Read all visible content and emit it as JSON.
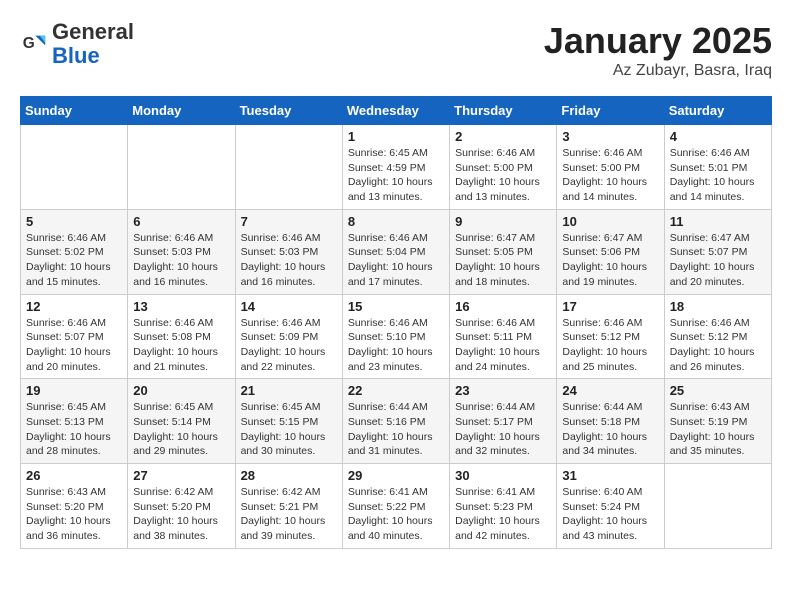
{
  "header": {
    "logo_general": "General",
    "logo_blue": "Blue",
    "month_title": "January 2025",
    "location": "Az Zubayr, Basra, Iraq"
  },
  "days_of_week": [
    "Sunday",
    "Monday",
    "Tuesday",
    "Wednesday",
    "Thursday",
    "Friday",
    "Saturday"
  ],
  "weeks": [
    [
      {
        "day": "",
        "info": ""
      },
      {
        "day": "",
        "info": ""
      },
      {
        "day": "",
        "info": ""
      },
      {
        "day": "1",
        "info": "Sunrise: 6:45 AM\nSunset: 4:59 PM\nDaylight: 10 hours\nand 13 minutes."
      },
      {
        "day": "2",
        "info": "Sunrise: 6:46 AM\nSunset: 5:00 PM\nDaylight: 10 hours\nand 13 minutes."
      },
      {
        "day": "3",
        "info": "Sunrise: 6:46 AM\nSunset: 5:00 PM\nDaylight: 10 hours\nand 14 minutes."
      },
      {
        "day": "4",
        "info": "Sunrise: 6:46 AM\nSunset: 5:01 PM\nDaylight: 10 hours\nand 14 minutes."
      }
    ],
    [
      {
        "day": "5",
        "info": "Sunrise: 6:46 AM\nSunset: 5:02 PM\nDaylight: 10 hours\nand 15 minutes."
      },
      {
        "day": "6",
        "info": "Sunrise: 6:46 AM\nSunset: 5:03 PM\nDaylight: 10 hours\nand 16 minutes."
      },
      {
        "day": "7",
        "info": "Sunrise: 6:46 AM\nSunset: 5:03 PM\nDaylight: 10 hours\nand 16 minutes."
      },
      {
        "day": "8",
        "info": "Sunrise: 6:46 AM\nSunset: 5:04 PM\nDaylight: 10 hours\nand 17 minutes."
      },
      {
        "day": "9",
        "info": "Sunrise: 6:47 AM\nSunset: 5:05 PM\nDaylight: 10 hours\nand 18 minutes."
      },
      {
        "day": "10",
        "info": "Sunrise: 6:47 AM\nSunset: 5:06 PM\nDaylight: 10 hours\nand 19 minutes."
      },
      {
        "day": "11",
        "info": "Sunrise: 6:47 AM\nSunset: 5:07 PM\nDaylight: 10 hours\nand 20 minutes."
      }
    ],
    [
      {
        "day": "12",
        "info": "Sunrise: 6:46 AM\nSunset: 5:07 PM\nDaylight: 10 hours\nand 20 minutes."
      },
      {
        "day": "13",
        "info": "Sunrise: 6:46 AM\nSunset: 5:08 PM\nDaylight: 10 hours\nand 21 minutes."
      },
      {
        "day": "14",
        "info": "Sunrise: 6:46 AM\nSunset: 5:09 PM\nDaylight: 10 hours\nand 22 minutes."
      },
      {
        "day": "15",
        "info": "Sunrise: 6:46 AM\nSunset: 5:10 PM\nDaylight: 10 hours\nand 23 minutes."
      },
      {
        "day": "16",
        "info": "Sunrise: 6:46 AM\nSunset: 5:11 PM\nDaylight: 10 hours\nand 24 minutes."
      },
      {
        "day": "17",
        "info": "Sunrise: 6:46 AM\nSunset: 5:12 PM\nDaylight: 10 hours\nand 25 minutes."
      },
      {
        "day": "18",
        "info": "Sunrise: 6:46 AM\nSunset: 5:12 PM\nDaylight: 10 hours\nand 26 minutes."
      }
    ],
    [
      {
        "day": "19",
        "info": "Sunrise: 6:45 AM\nSunset: 5:13 PM\nDaylight: 10 hours\nand 28 minutes."
      },
      {
        "day": "20",
        "info": "Sunrise: 6:45 AM\nSunset: 5:14 PM\nDaylight: 10 hours\nand 29 minutes."
      },
      {
        "day": "21",
        "info": "Sunrise: 6:45 AM\nSunset: 5:15 PM\nDaylight: 10 hours\nand 30 minutes."
      },
      {
        "day": "22",
        "info": "Sunrise: 6:44 AM\nSunset: 5:16 PM\nDaylight: 10 hours\nand 31 minutes."
      },
      {
        "day": "23",
        "info": "Sunrise: 6:44 AM\nSunset: 5:17 PM\nDaylight: 10 hours\nand 32 minutes."
      },
      {
        "day": "24",
        "info": "Sunrise: 6:44 AM\nSunset: 5:18 PM\nDaylight: 10 hours\nand 34 minutes."
      },
      {
        "day": "25",
        "info": "Sunrise: 6:43 AM\nSunset: 5:19 PM\nDaylight: 10 hours\nand 35 minutes."
      }
    ],
    [
      {
        "day": "26",
        "info": "Sunrise: 6:43 AM\nSunset: 5:20 PM\nDaylight: 10 hours\nand 36 minutes."
      },
      {
        "day": "27",
        "info": "Sunrise: 6:42 AM\nSunset: 5:20 PM\nDaylight: 10 hours\nand 38 minutes."
      },
      {
        "day": "28",
        "info": "Sunrise: 6:42 AM\nSunset: 5:21 PM\nDaylight: 10 hours\nand 39 minutes."
      },
      {
        "day": "29",
        "info": "Sunrise: 6:41 AM\nSunset: 5:22 PM\nDaylight: 10 hours\nand 40 minutes."
      },
      {
        "day": "30",
        "info": "Sunrise: 6:41 AM\nSunset: 5:23 PM\nDaylight: 10 hours\nand 42 minutes."
      },
      {
        "day": "31",
        "info": "Sunrise: 6:40 AM\nSunset: 5:24 PM\nDaylight: 10 hours\nand 43 minutes."
      },
      {
        "day": "",
        "info": ""
      }
    ]
  ]
}
